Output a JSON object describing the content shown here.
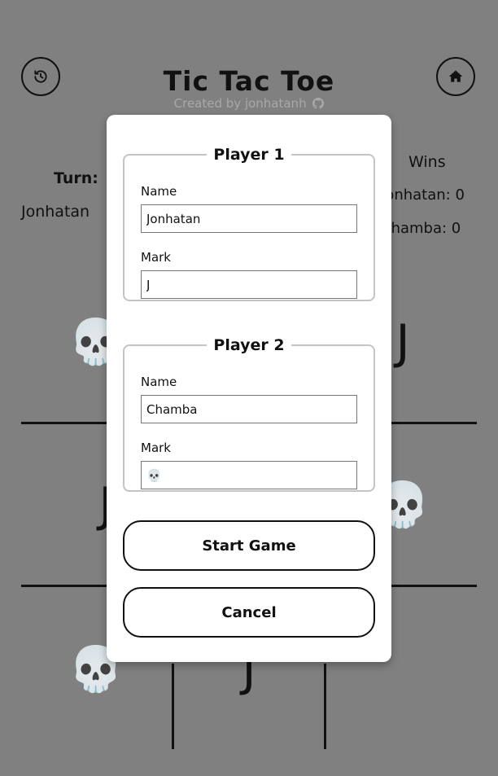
{
  "header": {
    "title": "Tic Tac Toe",
    "subtitle": "Created by jonhatanh"
  },
  "turn": {
    "label": "Turn:",
    "current_player": "Jonhatan"
  },
  "scoreboard": {
    "label": "Wins",
    "entries": [
      {
        "name": "Jonhatan",
        "wins": 0,
        "text": "Jonhatan: 0"
      },
      {
        "name": "Chamba",
        "wins": 0,
        "text": "Chamba: 0"
      }
    ]
  },
  "board": {
    "cells": [
      "💀",
      "",
      "J",
      "J",
      "",
      "💀",
      "💀",
      "J",
      ""
    ]
  },
  "modal": {
    "player1": {
      "legend": "Player 1",
      "name_label": "Name",
      "name_value": "Jonhatan",
      "mark_label": "Mark",
      "mark_value": "J"
    },
    "player2": {
      "legend": "Player 2",
      "name_label": "Name",
      "name_value": "Chamba",
      "mark_label": "Mark",
      "mark_value": "💀"
    },
    "start_label": "Start Game",
    "cancel_label": "Cancel"
  },
  "icons": {
    "history": "history-icon",
    "home": "home-icon",
    "github": "github-icon"
  },
  "colors": {
    "overlay": "#808080",
    "modal_bg": "#ffffff",
    "subtitle": "#a8a8a8",
    "ink": "#111111"
  }
}
